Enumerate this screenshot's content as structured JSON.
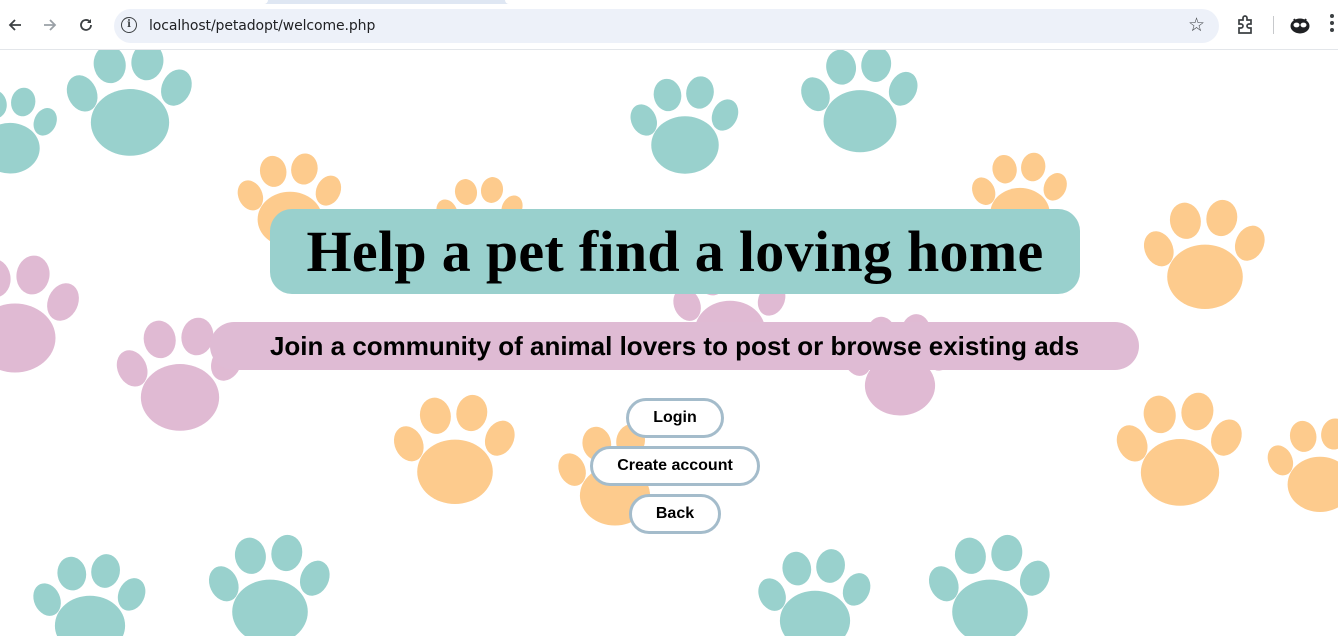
{
  "browser": {
    "url": "localhost/petadopt/welcome.php",
    "icons": {
      "back": "arrow-left-icon",
      "forward": "arrow-right-icon",
      "reload": "reload-icon",
      "site_info": "info-icon",
      "bookmark": "star-icon",
      "extensions": "puzzle-icon",
      "profile": "profile-icon",
      "menu": "kebab-menu-icon"
    }
  },
  "page": {
    "headline": "Help a pet find a loving home",
    "subheadline": "Join a community of animal lovers to post or browse existing ads",
    "buttons": {
      "login": "Login",
      "create_account": "Create account",
      "back": "Back"
    },
    "colors": {
      "headline_bg": "#99d0cd",
      "subheadline_bg": "#dfbbd4",
      "button_border": "#a4bccb",
      "paw_teal": "#99d1cd",
      "paw_orange": "#fdcb8d",
      "paw_pink": "#e0bad3"
    },
    "background_icon": "paw-print-icon"
  }
}
